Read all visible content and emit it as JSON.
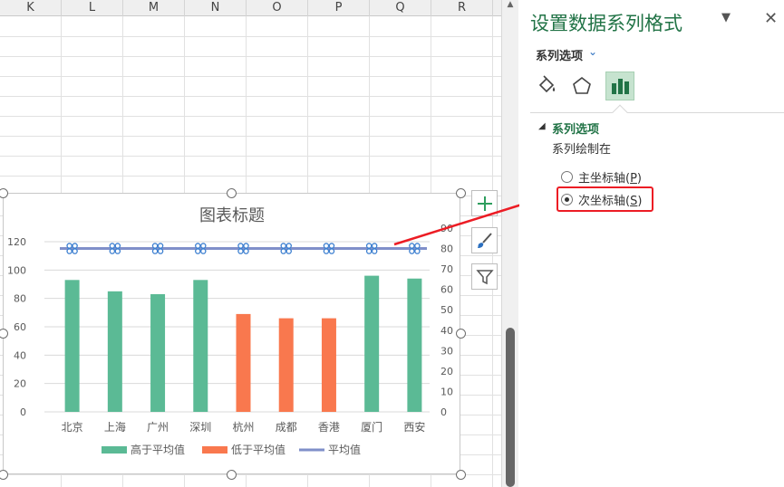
{
  "sheet": {
    "columns": [
      "K",
      "L",
      "M",
      "N",
      "O",
      "P",
      "Q",
      "R"
    ]
  },
  "chart": {
    "tools": {
      "elements_icon": "plus-icon",
      "styles_icon": "brush-icon",
      "filter_icon": "filter-icon"
    }
  },
  "chart_data": {
    "type": "bar",
    "title": "图表标题",
    "categories": [
      "北京",
      "上海",
      "广州",
      "深圳",
      "杭州",
      "成都",
      "香港",
      "厦门",
      "西安"
    ],
    "series": [
      {
        "name": "高于平均值",
        "values": [
          93,
          85,
          83,
          93,
          null,
          null,
          null,
          96,
          94
        ],
        "color": "#5bba95"
      },
      {
        "name": "低于平均值",
        "values": [
          null,
          null,
          null,
          null,
          69,
          66,
          66,
          null,
          null
        ],
        "color": "#f9784e"
      },
      {
        "name": "平均值",
        "type": "line",
        "axis": "secondary",
        "values": [
          80,
          80,
          80,
          80,
          80,
          80,
          80,
          80,
          80
        ],
        "color": "#7f8fc9"
      }
    ],
    "primary_y": {
      "ticks": [
        "0",
        "20",
        "40",
        "60",
        "80",
        "100",
        "120"
      ],
      "ylim": [
        0,
        120
      ]
    },
    "secondary_y": {
      "ticks": [
        "0",
        "10",
        "20",
        "30",
        "40",
        "50",
        "60",
        "70",
        "80",
        "90"
      ],
      "ylim": [
        0,
        90
      ]
    },
    "legend": {
      "position": "bottom",
      "items": [
        "高于平均值",
        "低于平均值",
        "平均值"
      ]
    }
  },
  "pane": {
    "title": "设置数据系列格式",
    "subtitle": "系列选项",
    "tab_icons": [
      "paint-bucket-icon",
      "pentagon-icon",
      "bar-chart-icon"
    ],
    "section_title": "系列选项",
    "plot_on_label": "系列绘制在",
    "option_primary": "主坐标轴(",
    "option_primary_key": "P",
    "option_secondary": "次坐标轴(",
    "option_secondary_key": "S",
    "selected": "secondary",
    "accent_color": "#217346",
    "annotation_color": "#ec1c24"
  }
}
